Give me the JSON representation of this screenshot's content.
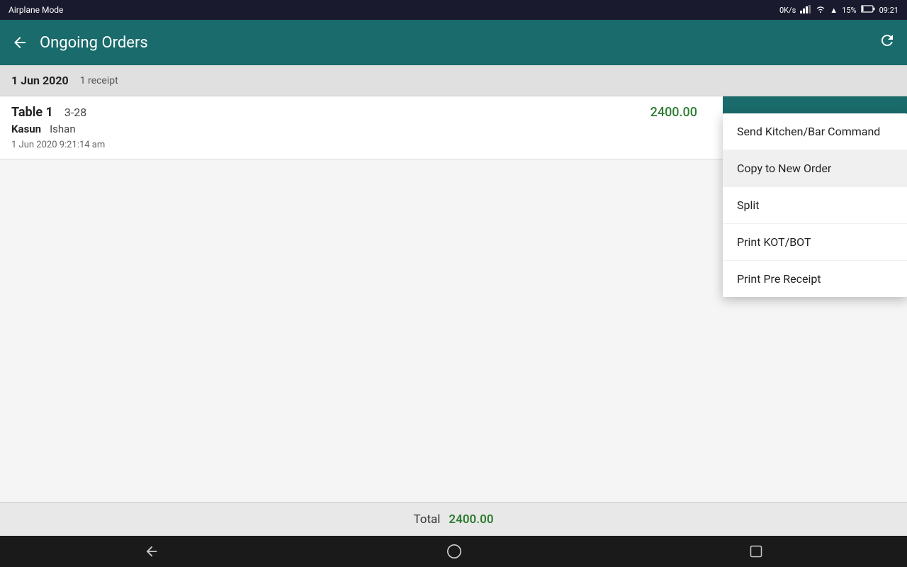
{
  "status_bar": {
    "airplane_mode": "Airplane Mode",
    "network_speed": "0K/s",
    "battery": "15%",
    "time": "09:21"
  },
  "app_bar": {
    "title": "Ongoing Orders",
    "back_icon": "←",
    "refresh_icon": "↻"
  },
  "date_section": {
    "date": "1 Jun 2020",
    "receipt_count": "1 receipt"
  },
  "order": {
    "table": "Table 1",
    "code": "3-28",
    "amount": "2400.00",
    "waiter": "Kasun",
    "server": "Ishan",
    "datetime": "1 Jun 2020 9:21:14 am"
  },
  "action_icons": {
    "check": "✓",
    "edit": "✎",
    "delete": "🗑",
    "more": "⋮"
  },
  "dropdown_menu": {
    "items": [
      {
        "id": "send-kitchen",
        "label": "Send Kitchen/Bar Command"
      },
      {
        "id": "copy-new-order",
        "label": "Copy to New Order",
        "highlighted": true
      },
      {
        "id": "split",
        "label": "Split"
      },
      {
        "id": "print-kot",
        "label": "Print KOT/BOT"
      },
      {
        "id": "print-pre-receipt",
        "label": "Print Pre Receipt"
      }
    ]
  },
  "footer": {
    "total_label": "Total",
    "total_amount": "2400.00"
  },
  "nav_bar": {
    "back": "◁",
    "home": "○",
    "recents": "□"
  },
  "colors": {
    "header_bg": "#1a6b6b",
    "amount_green": "#2e7d32",
    "status_bg": "#1a1a2e"
  }
}
